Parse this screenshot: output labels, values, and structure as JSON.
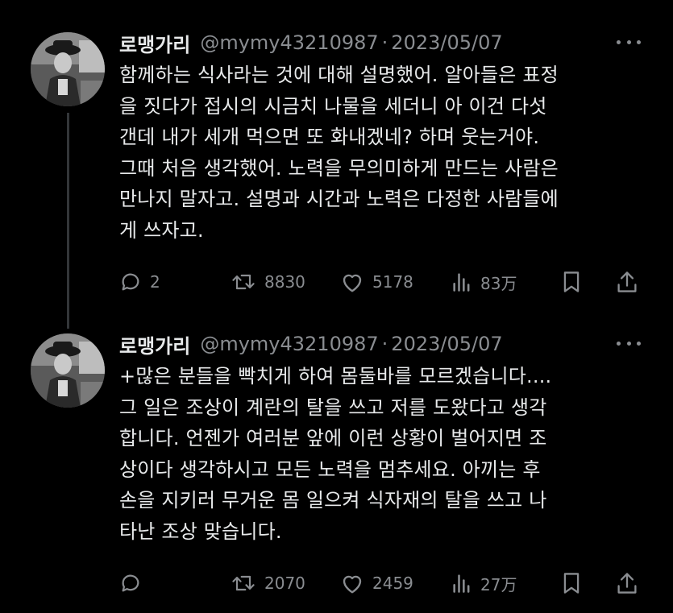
{
  "colors": {
    "background": "#000000",
    "text": "#e7e9ea",
    "muted": "#8a8d91",
    "thread_line": "#333639"
  },
  "tweets": [
    {
      "name": "로맹가리",
      "handle": "@mymy43210987",
      "separator": "·",
      "date": "2023/05/07",
      "lines": [
        "함께하는 식사라는 것에 대해 설명했어. 알아들은 표정",
        "을 짓다가 접시의 시금치 나물을 세더니 아 이건 다섯",
        "갠데 내가 세개 먹으면 또 화내겠네? 하며 웃는거야.",
        "그때 처음 생각했어. 노력을 무의미하게 만드는 사람은",
        "만나지 말자고. 설명과 시간과 노력은 다정한 사람들에",
        "게 쓰자고."
      ],
      "stats": {
        "replies": "2",
        "retweets": "8830",
        "likes": "5178",
        "views": "83万"
      },
      "icons": [
        "reply-icon",
        "retweet-icon",
        "like-icon",
        "views-icon",
        "bookmark-icon",
        "share-icon"
      ]
    },
    {
      "name": "로맹가리",
      "handle": "@mymy43210987",
      "separator": "·",
      "date": "2023/05/07",
      "lines": [
        "+많은 분들을 빡치게 하여 몸둘바를 모르겠습니다....",
        "그 일은 조상이 계란의 탈을 쓰고 저를 도왔다고 생각",
        "합니다. 언젠가 여러분 앞에 이런 상황이 벌어지면 조",
        "상이다 생각하시고 모든 노력을 멈추세요. 아끼는 후",
        "손을 지키러 무거운 몸 일으켜 식자재의 탈을 쓰고 나",
        "타난 조상 맞습니다."
      ],
      "stats": {
        "replies": "",
        "retweets": "2070",
        "likes": "2459",
        "views": "27万"
      },
      "icons": [
        "reply-icon",
        "retweet-icon",
        "like-icon",
        "views-icon",
        "bookmark-icon",
        "share-icon"
      ]
    }
  ]
}
